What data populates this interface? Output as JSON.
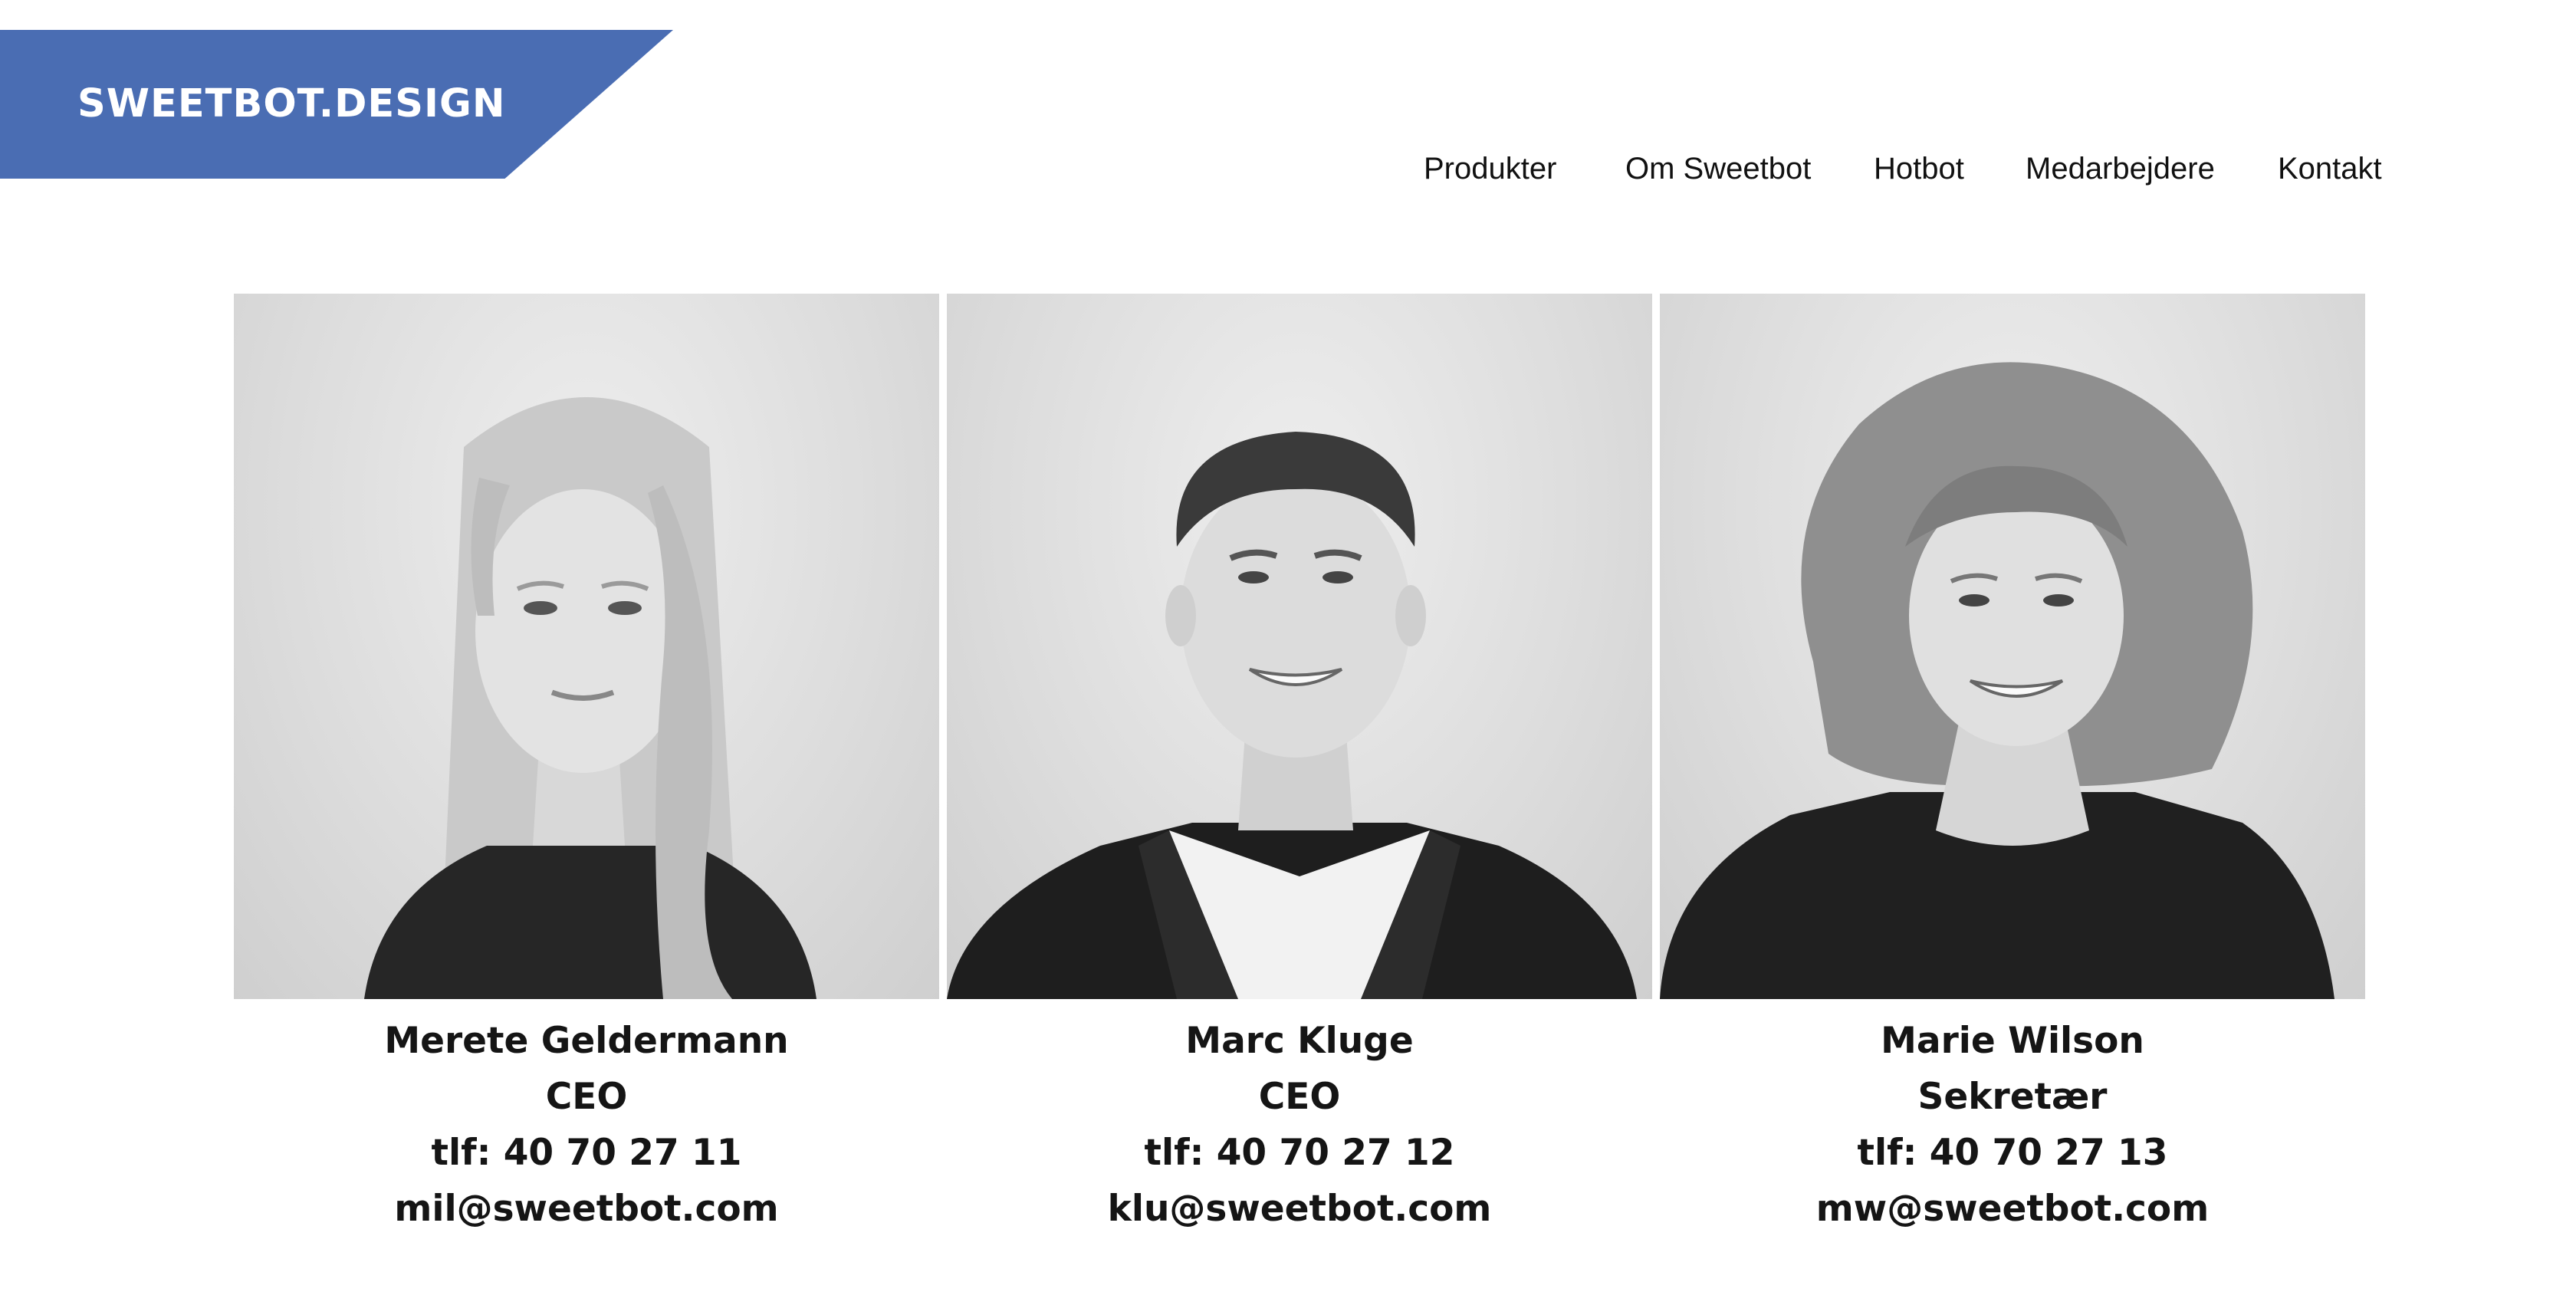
{
  "brand": {
    "logo_text": "SWEETBOT.DESIGN",
    "color": "#4a6db3"
  },
  "nav": {
    "items": [
      {
        "label": "Produkter"
      },
      {
        "label": "Om Sweetbot"
      },
      {
        "label": "Hotbot"
      },
      {
        "label": "Medarbejdere"
      },
      {
        "label": "Kontakt"
      }
    ]
  },
  "staff": [
    {
      "name": "Merete Geldermann",
      "title": "CEO",
      "phone": "tlf: 40 70 27 11",
      "email": "mil@sweetbot.com"
    },
    {
      "name": "Marc Kluge",
      "title": "CEO",
      "phone": "tlf: 40 70 27 12",
      "email": "klu@sweetbot.com"
    },
    {
      "name": "Marie Wilson",
      "title": "Sekretær",
      "phone": "tlf: 40 70 27 13",
      "email": "mw@sweetbot.com"
    }
  ]
}
